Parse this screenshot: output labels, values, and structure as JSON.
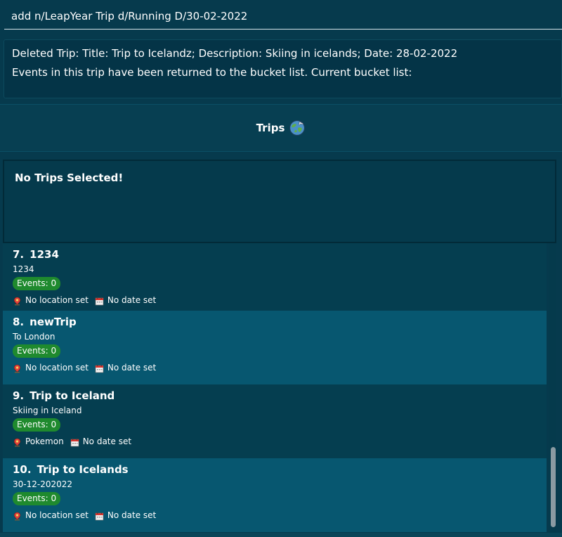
{
  "command": {
    "value": "add n/LeapYear Trip d/Running D/30-02-2022"
  },
  "result": {
    "line1": "Deleted Trip: Title: Trip to Icelandz; Description: Skiing in icelands; Date: 28-02-2022",
    "line2": "Events in this trip have been returned to the bucket list. Current bucket list:"
  },
  "header": {
    "title": "Trips",
    "icon": "globe-icon"
  },
  "selected": {
    "text": "No Trips Selected!"
  },
  "trips": [
    {
      "index": "7.",
      "title": "1234",
      "description": "1234",
      "events": "Events: 0",
      "location": "No location set",
      "date": "No date set"
    },
    {
      "index": "8.",
      "title": "newTrip",
      "description": "To London",
      "events": "Events: 0",
      "location": "No location set",
      "date": "No date set"
    },
    {
      "index": "9.",
      "title": "Trip to Iceland",
      "description": "Skiing in Iceland",
      "events": "Events: 0",
      "location": "Pokemon",
      "date": "No date set"
    },
    {
      "index": "10.",
      "title": "Trip to Icelands",
      "description": "30-12-202022",
      "events": "Events: 0",
      "location": "No location set",
      "date": "No date set"
    }
  ],
  "colors": {
    "background": "#063a4d",
    "badge": "#1f8a2e",
    "card_alt": "#075770"
  }
}
